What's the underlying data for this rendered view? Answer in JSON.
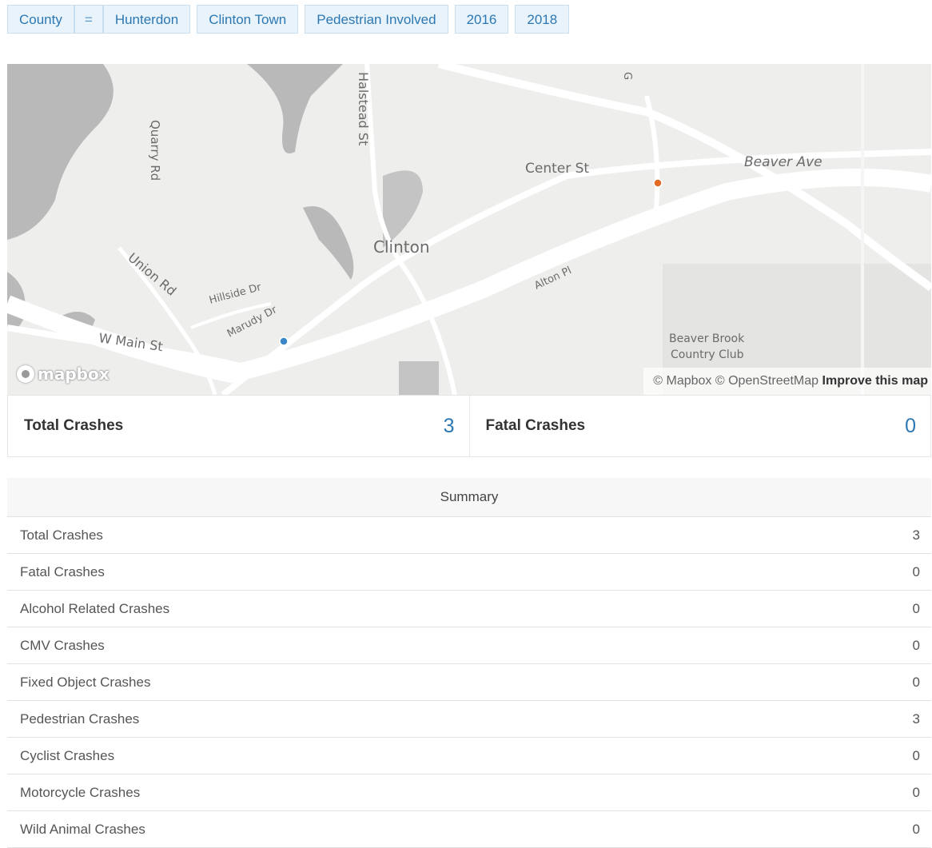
{
  "filters": {
    "county_field": "County",
    "operator": "=",
    "county_value": "Hunterdon",
    "municipality": "Clinton Town",
    "crash_type": "Pedestrian Involved",
    "year_start": "2016",
    "year_end": "2018"
  },
  "map": {
    "labels": {
      "quarry": "Quarry Rd",
      "halstead": "Halstead St",
      "center": "Center St",
      "beaver_ave": "Beaver Ave",
      "clinton": "Clinton",
      "union": "Union Rd",
      "hillside": "Hillside Dr",
      "marudy": "Marudy Dr",
      "alton": "Alton Pl",
      "wmain": "W Main St",
      "club_line1": "Beaver Brook",
      "club_line2": "Country Club",
      "route": "G"
    },
    "logo_text": "mapbox",
    "attribution": "© Mapbox © OpenStreetMap",
    "improve_link": "Improve this map",
    "marker_colors": {
      "blue": "#3b86c8",
      "orange": "#e56a24"
    }
  },
  "stats": {
    "total_label": "Total Crashes",
    "total_value": "3",
    "fatal_label": "Fatal Crashes",
    "fatal_value": "0"
  },
  "summary": {
    "header": "Summary",
    "rows": [
      {
        "label": "Total Crashes",
        "value": "3"
      },
      {
        "label": "Fatal Crashes",
        "value": "0"
      },
      {
        "label": "Alcohol Related Crashes",
        "value": "0"
      },
      {
        "label": "CMV Crashes",
        "value": "0"
      },
      {
        "label": "Fixed Object Crashes",
        "value": "0"
      },
      {
        "label": "Pedestrian Crashes",
        "value": "3"
      },
      {
        "label": "Cyclist Crashes",
        "value": "0"
      },
      {
        "label": "Motorcycle Crashes",
        "value": "0"
      },
      {
        "label": "Wild Animal Crashes",
        "value": "0"
      }
    ]
  }
}
